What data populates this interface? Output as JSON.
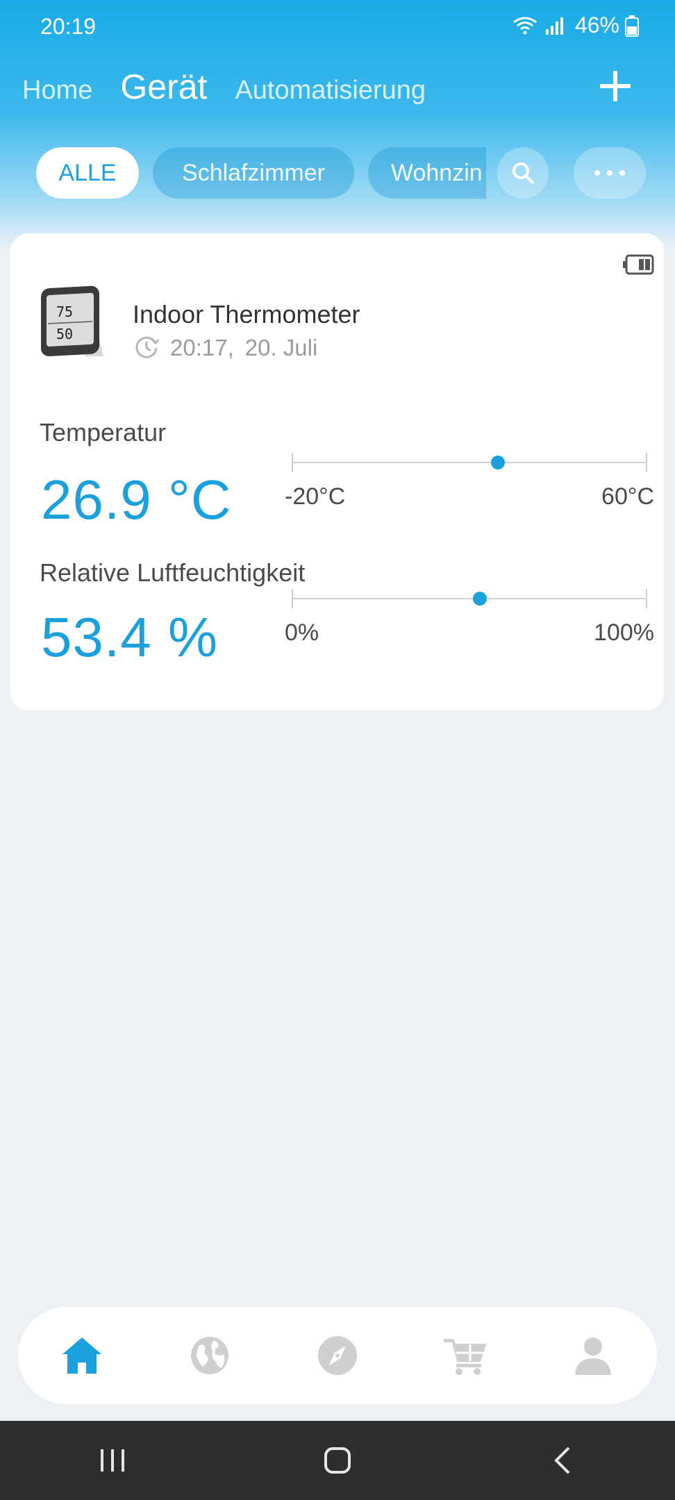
{
  "status_bar": {
    "time": "20:19",
    "battery": "46%"
  },
  "top_tabs": [
    {
      "label": "Home",
      "active": false
    },
    {
      "label": "Gerät",
      "active": true
    },
    {
      "label": "Automatisierung",
      "active": false
    }
  ],
  "filters": [
    {
      "label": "ALLE",
      "selected": true
    },
    {
      "label": "Schlafzimmer",
      "selected": false
    },
    {
      "label": "Wohnzin",
      "selected": false
    }
  ],
  "device": {
    "name": "Indoor Thermometer",
    "time": "20:17,",
    "date": "20. Juli",
    "metrics": [
      {
        "label": "Temperatur",
        "value": "26.9 °C",
        "min": "-20°C",
        "max": "60°C",
        "level": 0.58
      },
      {
        "label": "Relative Luftfeuchtigkeit",
        "value": "53.4 %",
        "min": "0%",
        "max": "100%",
        "level": 0.53
      }
    ]
  },
  "bottom_nav": [
    {
      "icon": "home-icon",
      "active": true
    },
    {
      "icon": "globe-icon",
      "active": false
    },
    {
      "icon": "compass-icon",
      "active": false
    },
    {
      "icon": "cart-icon",
      "active": false
    },
    {
      "icon": "profile-icon",
      "active": false
    }
  ],
  "colors": {
    "accent": "#1aa0dd",
    "header": "#19abe6",
    "background": "#edf1f5",
    "inactive_icon": "#cfcfcf"
  }
}
